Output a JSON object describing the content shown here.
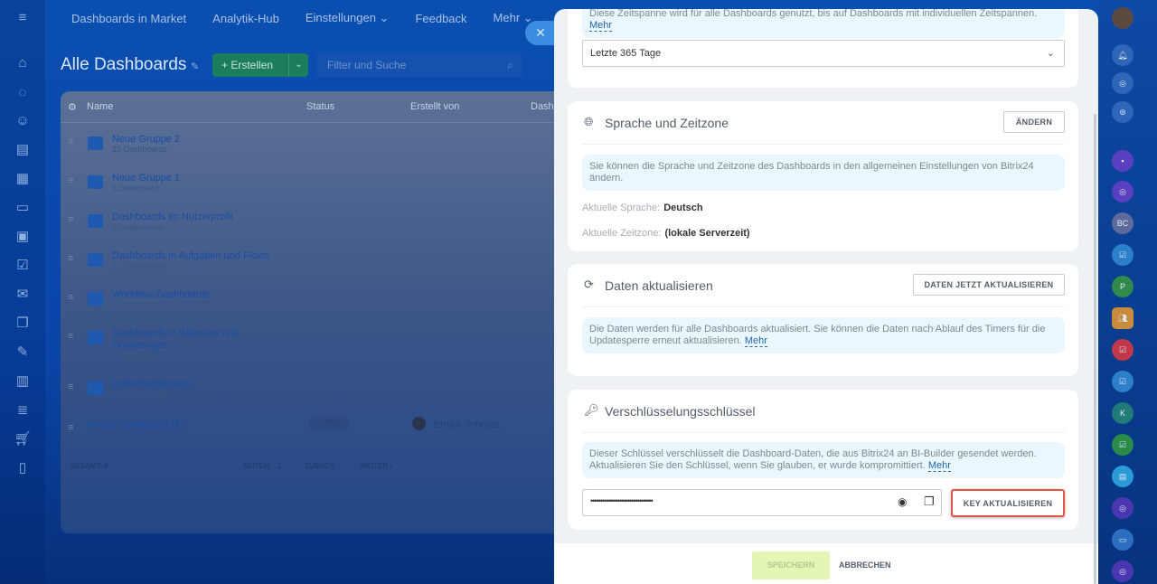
{
  "topnav": {
    "items": [
      "Dashboards in Market",
      "Analytik-Hub",
      "Einstellungen ⌄",
      "Feedback",
      "Mehr ⌄"
    ]
  },
  "page": {
    "title": "Alle Dashboards",
    "create_label": "+ Erstellen",
    "search_placeholder": "Filter und Suche"
  },
  "grid": {
    "columns": [
      "Name",
      "Status",
      "Erstellt von",
      "Dashb"
    ],
    "groups": [
      {
        "name": "Neue Gruppe 2",
        "count": "25 Dashboards"
      },
      {
        "name": "Neue Gruppe 1",
        "count": "1 Dashboard"
      },
      {
        "name": "Dashboards im Nutzerprofil",
        "count": "5 Dashboards"
      },
      {
        "name": "Dashboards in Aufgaben und Flows",
        "count": "10 Dashboards"
      },
      {
        "name": "Workflow-Dashboards",
        "count": "4 Dashboards"
      },
      {
        "name": "Dashboards in Websites und Onlineshops",
        "count": "6 Dashboards"
      },
      {
        "name": "CRM-Dashboards",
        "count": "21 Dashboards"
      }
    ],
    "dashboard": {
      "name": "Neues Dashboard (1)",
      "status": "ENTWURF",
      "author": "Emilia Schmidt"
    },
    "footer": {
      "total": "GESAMT: 8",
      "pages": "SEITEN:",
      "page": "1",
      "prev": "‹ ZURÜCK",
      "next": "WEITER ›"
    }
  },
  "panel": {
    "period": {
      "info": "Diese Zeitspanne wird für alle Dashboards genutzt, bis auf Dashboards mit individuellen Zeitspannen.",
      "more": "Mehr",
      "selected": "Letzte 365 Tage"
    },
    "language": {
      "title": "Sprache und Zeitzone",
      "button": "ÄNDERN",
      "info": "Sie können die Sprache und Zeitzone des Dashboards in den allgemeinen Einstellungen von Bitrix24 ändern.",
      "lang_label": "Aktuelle Sprache:",
      "lang_value": "Deutsch",
      "tz_label": "Aktuelle Zeitzone:",
      "tz_value": "(lokale Serverzeit)"
    },
    "refresh": {
      "title": "Daten aktualisieren",
      "button": "DATEN JETZT AKTUALISIEREN",
      "info": "Die Daten werden für alle Dashboards aktualisiert. Sie können die Daten nach Ablauf des Timers für die Updatesperre erneut aktualisieren.",
      "more": "Mehr"
    },
    "key": {
      "title": "Verschlüsselungsschlüssel",
      "info": "Dieser Schlüssel verschlüsselt die Dashboard-Daten, die aus Bitrix24 an BI-Builder gesendet werden. Aktualisieren Sie den Schlüssel, wenn Sie glauben, er wurde kompromittiert.",
      "more": "Mehr",
      "value": "••••••••••••••••••••••••••••••••",
      "button": "KEY AKTUALISIEREN"
    },
    "footer": {
      "save": "SPEICHERN",
      "cancel": "ABBRECHEN"
    }
  },
  "rightbar": {
    "items": [
      "BC",
      "P",
      "K"
    ]
  },
  "colors": {
    "accent": "#2066b0",
    "highlight": "#e5534b",
    "save_disabled": "#e3f6b4"
  }
}
